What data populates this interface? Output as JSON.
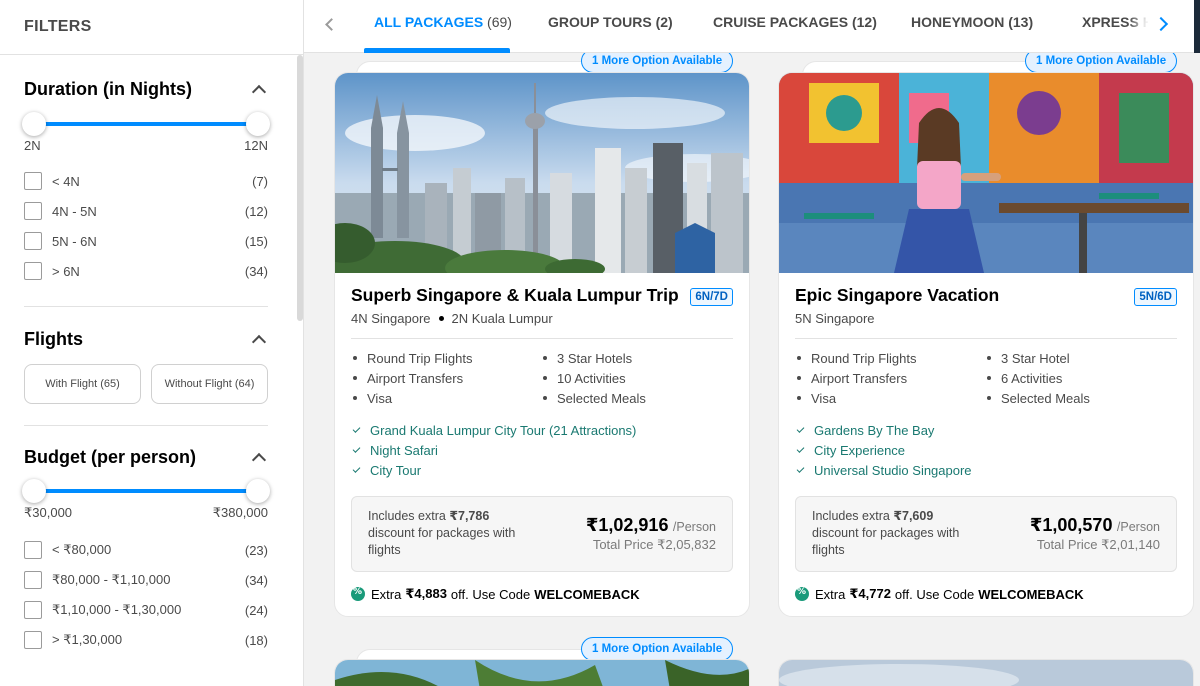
{
  "sidebar": {
    "title": "FILTERS",
    "duration": {
      "title": "Duration (in Nights)",
      "min_label": "2N",
      "max_label": "12N",
      "range_selected": [
        2,
        12
      ],
      "options": [
        {
          "label": "< 4N",
          "count": "(7)"
        },
        {
          "label": "4N - 5N",
          "count": "(12)"
        },
        {
          "label": "5N - 6N",
          "count": "(15)"
        },
        {
          "label": "> 6N",
          "count": "(34)"
        }
      ]
    },
    "flights": {
      "title": "Flights",
      "with_flight": "With Flight (65)",
      "without_flight": "Without Flight (64)"
    },
    "budget": {
      "title": "Budget (per person)",
      "min_label": "₹30,000",
      "max_label": "₹380,000",
      "options": [
        {
          "label": "< ₹80,000",
          "count": "(23)"
        },
        {
          "label": "₹80,000 - ₹1,10,000",
          "count": "(34)"
        },
        {
          "label": "₹1,10,000 - ₹1,30,000",
          "count": "(24)"
        },
        {
          "label": "> ₹1,30,000",
          "count": "(18)"
        }
      ]
    }
  },
  "tabs": [
    {
      "label": "ALL PACKAGES",
      "count": "(69)",
      "active": true
    },
    {
      "label": "GROUP TOURS (2)",
      "count": "",
      "active": false
    },
    {
      "label": "CRUISE PACKAGES (12)",
      "count": "",
      "active": false
    },
    {
      "label": "HONEYMOON (13)",
      "count": "",
      "active": false
    },
    {
      "label": "XPRESS H",
      "count": "",
      "active": false
    }
  ],
  "more_option_label": "1 More Option Available",
  "cards": [
    {
      "title": "Superb Singapore & Kuala Lumpur Trip",
      "duration": "6N/7D",
      "destinations": [
        "4N Singapore",
        "2N Kuala Lumpur"
      ],
      "inclusions": [
        "Round Trip Flights",
        "3 Star Hotels",
        "Airport Transfers",
        "10 Activities",
        "Visa",
        "Selected Meals"
      ],
      "highlights": [
        "Grand Kuala Lumpur City Tour (21 Attractions)",
        "Night Safari",
        "City Tour"
      ],
      "discount_prefix": "Includes extra",
      "discount_amount": "₹7,786",
      "discount_suffix": "discount for packages with flights",
      "price": "₹1,02,916",
      "per": "/Person",
      "total": "Total Price ₹2,05,832",
      "promo_prefix": "Extra",
      "promo_amount": "₹4,883",
      "promo_mid": "off. Use Code",
      "promo_code": "WELCOMEBACK"
    },
    {
      "title": "Epic Singapore Vacation",
      "duration": "5N/6D",
      "destinations": [
        "5N Singapore"
      ],
      "inclusions": [
        "Round Trip Flights",
        "3 Star Hotel",
        "Airport Transfers",
        "6 Activities",
        "Visa",
        "Selected Meals"
      ],
      "highlights": [
        "Gardens By The Bay",
        "City Experience",
        "Universal Studio Singapore"
      ],
      "discount_prefix": "Includes extra",
      "discount_amount": "₹7,609",
      "discount_suffix": "discount for packages with flights",
      "price": "₹1,00,570",
      "per": "/Person",
      "total": "Total Price ₹2,01,140",
      "promo_prefix": "Extra",
      "promo_amount": "₹4,772",
      "promo_mid": "off. Use Code",
      "promo_code": "WELCOMEBACK"
    }
  ],
  "colors": {
    "accent": "#008cff",
    "highlight_green": "#1a7971",
    "badge_bg": "#e4f1ff"
  }
}
